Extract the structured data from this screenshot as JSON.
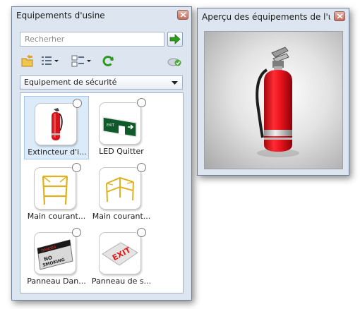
{
  "left_panel": {
    "title": "Equipements d'usine",
    "search_placeholder": "Recherher",
    "category": "Equipement de sécurité",
    "items": [
      {
        "label": "Extincteur d'i...",
        "icon": "fire-extinguisher-icon"
      },
      {
        "label": "LED Quitter",
        "icon": "exit-sign-icon"
      },
      {
        "label": "Main courant...",
        "icon": "handrail-icon"
      },
      {
        "label": "Main courant...",
        "icon": "handrail-icon"
      },
      {
        "label": "Panneau Dan...",
        "icon": "danger-sign-icon"
      },
      {
        "label": "Panneau de s...",
        "icon": "exit-floor-sign-icon"
      }
    ]
  },
  "right_panel": {
    "title": "Aperçu des équipements de l'usine"
  },
  "colors": {
    "panel_bg": "#dde6f0",
    "selection": "#dcebfa",
    "extinguisher_red": "#e8121c",
    "go_green": "#2f9a22"
  }
}
